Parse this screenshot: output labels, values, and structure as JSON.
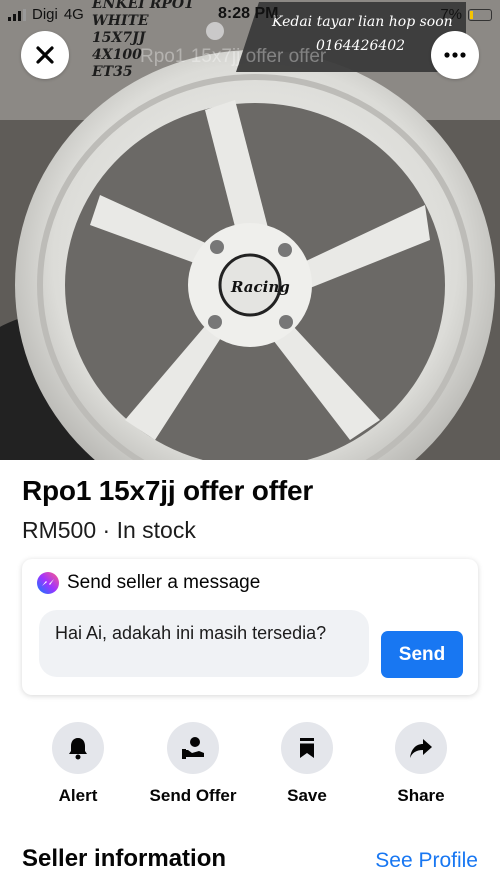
{
  "status_bar": {
    "carrier": "Digi",
    "network": "4G",
    "time": "8:28 PM",
    "battery": "7%"
  },
  "photo_overlay": {
    "spec_lines": [
      "ENKEI RPO1",
      "WHITE",
      "15X7JJ",
      "4X100",
      "ET35"
    ],
    "shop_name": "Kedai tayar lian hop soon",
    "shop_phone": "0164426402",
    "ghost_title": "Rpo1 15x7jj offer offer",
    "hub_logo": "Racing"
  },
  "listing": {
    "title": "Rpo1 15x7jj offer offer",
    "price_line": "RM500 · In stock"
  },
  "message_card": {
    "heading": "Send seller a message",
    "input_text": "Hai Ai, adakah ini masih tersedia?",
    "send_label": "Send"
  },
  "actions": [
    {
      "label": "Alert",
      "icon": "bell-icon"
    },
    {
      "label": "Send Offer",
      "icon": "offer-icon"
    },
    {
      "label": "Save",
      "icon": "bookmark-icon"
    },
    {
      "label": "Share",
      "icon": "share-icon"
    }
  ],
  "seller_section": {
    "heading": "Seller information",
    "link": "See Profile"
  },
  "colors": {
    "accent": "#1877f2",
    "icon_bg": "#e4e6eb",
    "input_bg": "#f0f2f5"
  }
}
